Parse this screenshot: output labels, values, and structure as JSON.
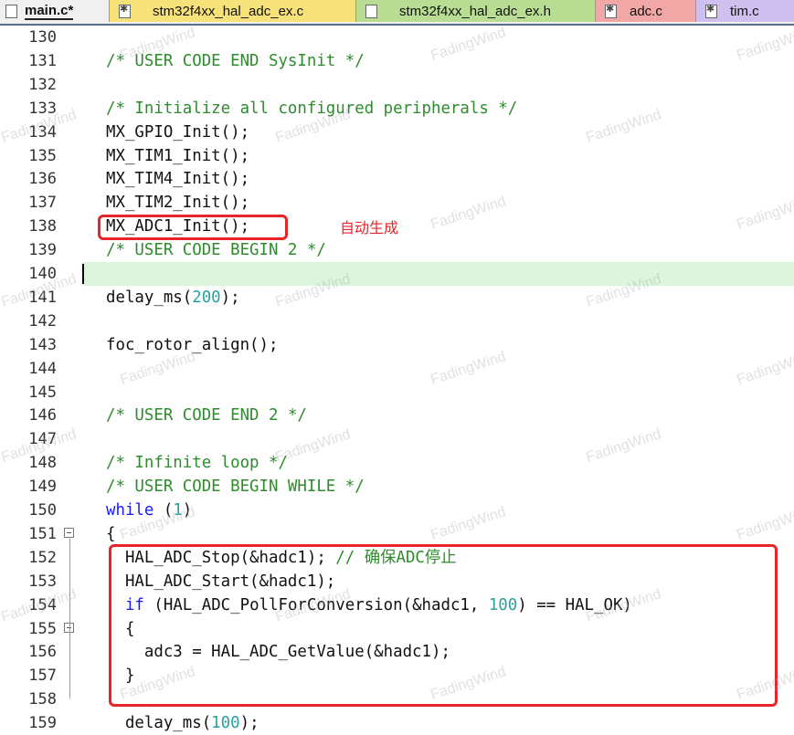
{
  "tabs": [
    {
      "label": "main.c*",
      "icon": "file-icon",
      "color": "#f0f0f0",
      "active": true
    },
    {
      "label": "stm32f4xx_hal_adc_ex.c",
      "icon": "gear-file-icon",
      "color": "#f7e27a"
    },
    {
      "label": "stm32f4xx_hal_adc_ex.h",
      "icon": "file-icon",
      "color": "#b9dd92"
    },
    {
      "label": "adc.c",
      "icon": "gear-file-icon",
      "color": "#f2a7a7"
    },
    {
      "label": "tim.c",
      "icon": "gear-file-icon",
      "color": "#cfc0f0"
    }
  ],
  "lines": [
    {
      "n": "130",
      "text": ""
    },
    {
      "n": "131",
      "text": "/* USER CODE END SysInit */"
    },
    {
      "n": "132",
      "text": ""
    },
    {
      "n": "133",
      "text": "/* Initialize all configured peripherals */"
    },
    {
      "n": "134",
      "text": "MX_GPIO_Init();"
    },
    {
      "n": "135",
      "text": "MX_TIM1_Init();"
    },
    {
      "n": "136",
      "text": "MX_TIM4_Init();"
    },
    {
      "n": "137",
      "text": "MX_TIM2_Init();"
    },
    {
      "n": "138",
      "text": "MX_ADC1_Init();"
    },
    {
      "n": "139",
      "text": "/* USER CODE BEGIN 2 */"
    },
    {
      "n": "140",
      "text": ""
    },
    {
      "n": "141",
      "text": "delay_ms(200);"
    },
    {
      "n": "142",
      "text": ""
    },
    {
      "n": "143",
      "text": "foc_rotor_align();"
    },
    {
      "n": "144",
      "text": ""
    },
    {
      "n": "145",
      "text": ""
    },
    {
      "n": "146",
      "text": "/* USER CODE END 2 */"
    },
    {
      "n": "147",
      "text": ""
    },
    {
      "n": "148",
      "text": "/* Infinite loop */"
    },
    {
      "n": "149",
      "text": "/* USER CODE BEGIN WHILE */"
    },
    {
      "n": "150",
      "text": "while (1)"
    },
    {
      "n": "151",
      "text": "{"
    },
    {
      "n": "152",
      "text": "  HAL_ADC_Stop(&hadc1); // 确保ADC停止"
    },
    {
      "n": "153",
      "text": "  HAL_ADC_Start(&hadc1);"
    },
    {
      "n": "154",
      "text": "  if (HAL_ADC_PollForConversion(&hadc1, 100) == HAL_OK)"
    },
    {
      "n": "155",
      "text": "  {"
    },
    {
      "n": "156",
      "text": "    adc3 = HAL_ADC_GetValue(&hadc1);"
    },
    {
      "n": "157",
      "text": "  }"
    },
    {
      "n": "158",
      "text": ""
    },
    {
      "n": "159",
      "text": "  delay_ms(100);"
    }
  ],
  "annotation": {
    "text": "自动生成",
    "color": "#e8232a"
  },
  "watermark": "FadingWind",
  "colors": {
    "comment": "#2e8b2e",
    "keyword": "#1a1aff",
    "number": "#2aa0a0",
    "current_line": "#dcf5dc"
  }
}
